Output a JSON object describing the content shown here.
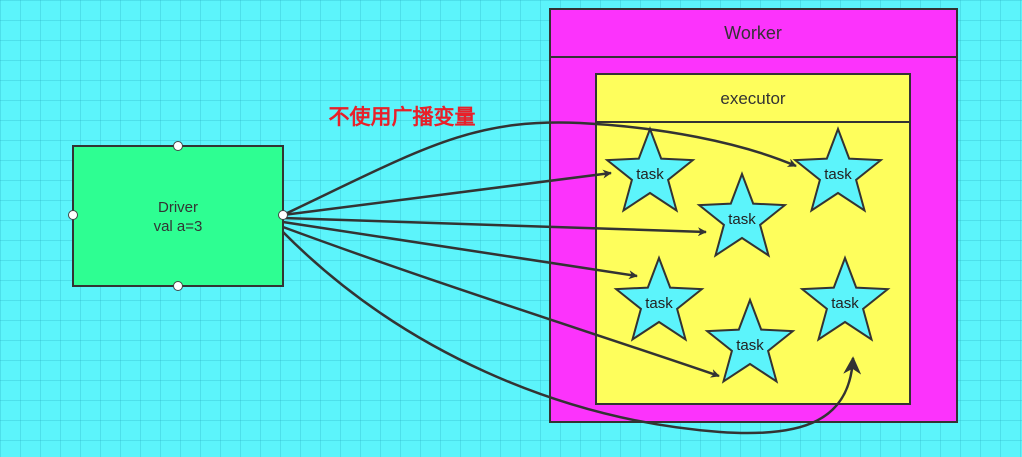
{
  "title": "不使用广播变量",
  "driver": {
    "line1": "Driver",
    "line2": "val a=3"
  },
  "worker": {
    "label": "Worker"
  },
  "executor": {
    "label": "executor"
  },
  "tasks": [
    {
      "label": "task"
    },
    {
      "label": "task"
    },
    {
      "label": "task"
    },
    {
      "label": "task"
    },
    {
      "label": "task"
    },
    {
      "label": "task"
    }
  ],
  "colors": {
    "background": "#5cf4fb",
    "driver_fill": "#2efe92",
    "worker_fill": "#fc33fc",
    "executor_fill": "#fefe5c",
    "task_fill": "#5cf4fb",
    "title_color": "#e8202a",
    "stroke": "#333333"
  }
}
